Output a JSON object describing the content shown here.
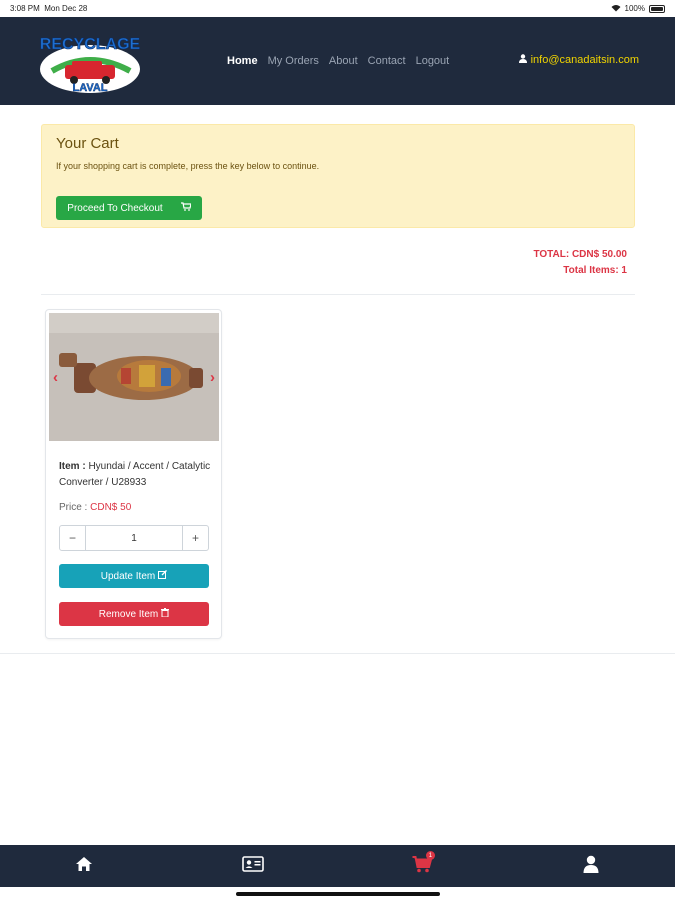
{
  "status": {
    "time": "3:08 PM",
    "date": "Mon Dec 28",
    "battery": "100%"
  },
  "brand": {
    "logo_top": "RECYCLAGE",
    "logo_bottom": "LAVAL"
  },
  "nav": {
    "items": [
      {
        "label": "Home",
        "active": true
      },
      {
        "label": "My Orders",
        "active": false
      },
      {
        "label": "About",
        "active": false
      },
      {
        "label": "Contact",
        "active": false
      },
      {
        "label": "Logout",
        "active": false
      }
    ],
    "email": "info@canadaitsin.com"
  },
  "cart": {
    "title": "Your Cart",
    "message": "If your shopping cart is complete, press the key below to continue.",
    "checkout_label": "Proceed To Checkout",
    "total": "TOTAL: CDN$ 50.00",
    "total_items": "Total Items: 1"
  },
  "item": {
    "label": "Item :",
    "name": "Hyundai / Accent / Catalytic Converter / U28933",
    "price_label": "Price :",
    "price": "CDN$ 50",
    "quantity": "1",
    "minus": "−",
    "plus": "+",
    "update_label": "Update Item",
    "remove_label": "Remove Item"
  },
  "tabbar": {
    "cart_badge": "1",
    "icons": [
      "home-icon",
      "id-card-icon",
      "cart-icon",
      "user-icon"
    ]
  },
  "colors": {
    "navbar": "#1f2a3d",
    "accent_email": "#f0d400",
    "checkout": "#28a745",
    "update": "#17a2b8",
    "remove": "#dc3545",
    "alert_bg": "#fdf2c7"
  }
}
